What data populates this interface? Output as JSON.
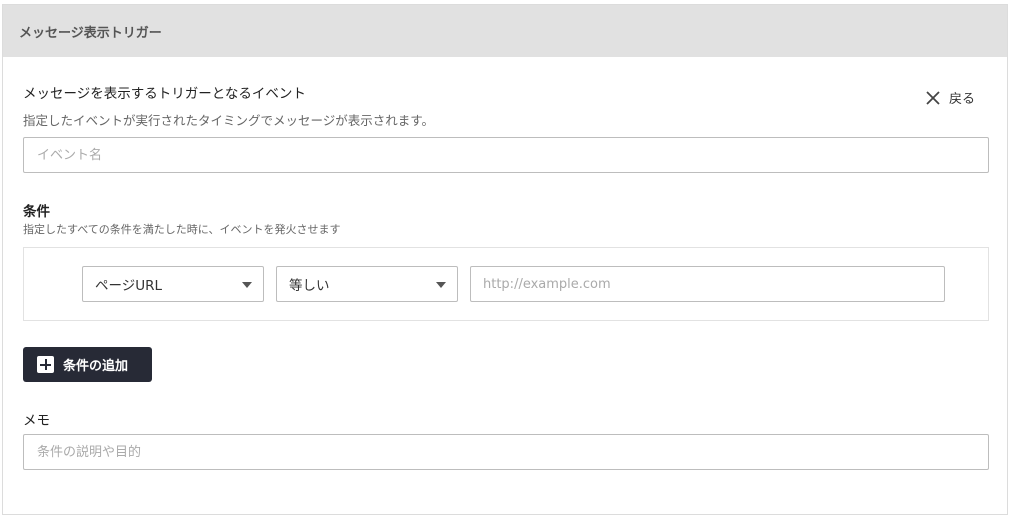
{
  "header": {
    "title": "メッセージ表示トリガー"
  },
  "event_section": {
    "title": "メッセージを表示するトリガーとなるイベント",
    "description": "指定したイベントが実行されたタイミングでメッセージが表示されます。",
    "input_placeholder": "イベント名",
    "input_value": ""
  },
  "back_button": {
    "label": "戻る",
    "icon": "close-icon"
  },
  "conditions": {
    "title": "条件",
    "description": "指定したすべての条件を満たした時に、イベントを発火させます",
    "rows": [
      {
        "target": "ページURL",
        "operator": "等しい",
        "value_placeholder": "http://example.com",
        "value": ""
      }
    ],
    "add_button_label": "条件の追加",
    "add_button_icon": "plus-icon"
  },
  "memo": {
    "title": "メモ",
    "placeholder": "条件の説明や目的",
    "value": ""
  },
  "colors": {
    "header_bg": "#e1e1e1",
    "primary_button": "#272a36",
    "border": "#bdbdbd"
  }
}
